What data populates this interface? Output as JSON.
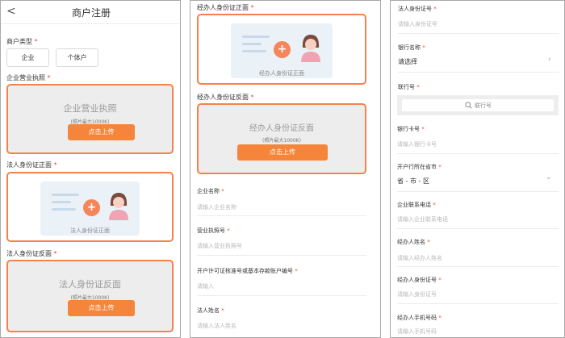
{
  "p1": {
    "back": "<",
    "title": "商户注册",
    "merchant_type_label": "商户类型",
    "required": "*",
    "type_company": "企业",
    "type_individual": "个体户",
    "license_label": "企业营业执照",
    "license_box_text": "企业营业执照",
    "size_hint": "(照片最大1000K)",
    "upload_btn": "点击上传",
    "legal_front_label": "法人身份证正面",
    "legal_front_caption": "法人身份证正面",
    "legal_back_label": "法人身份证反面",
    "legal_back_box_text": "法人身份证反面"
  },
  "p2": {
    "agent_front_label": "经办人身份证正面",
    "agent_front_caption": "经办人身份证正面",
    "agent_back_label": "经办人身份证反面",
    "agent_back_box_text": "经办人身份证反面",
    "size_hint": "(照片最大1000K)",
    "upload_btn": "点击上传",
    "company_name_label": "企业名称",
    "company_name_ph": "请输入企业名称",
    "license_no_label": "营业执照号",
    "license_no_ph": "请输入营业执照号",
    "permit_label": "开户许可证核准号或基本存款账户编号",
    "permit_ph": "请输入",
    "legal_name_label": "法人姓名",
    "legal_name_ph": "请输入法人姓名"
  },
  "p3": {
    "legal_id_label": "法人身份证号",
    "legal_id_ph": "请输入身份证号",
    "bank_label": "银行名称",
    "bank_value": "请选择",
    "chevron_right": "›",
    "unionno_label": "联行号",
    "unionno_search": "联行号",
    "card_label": "银行卡号",
    "card_ph": "请输入银行卡号",
    "region_label": "开户行所在省市",
    "region_value": "省 - 市 - 区",
    "chevron_down": "⌄",
    "phone_label": "企业联系电话",
    "phone_ph": "请输入企业联系电话",
    "agent_name_label": "经办人姓名",
    "agent_name_ph": "请输入经办人姓名",
    "agent_id_label": "经办人身份证号",
    "agent_id_ph": "请输入身份证号",
    "agent_mobile_label": "经办人手机号码",
    "agent_mobile_ph": "请输入手机号码"
  }
}
